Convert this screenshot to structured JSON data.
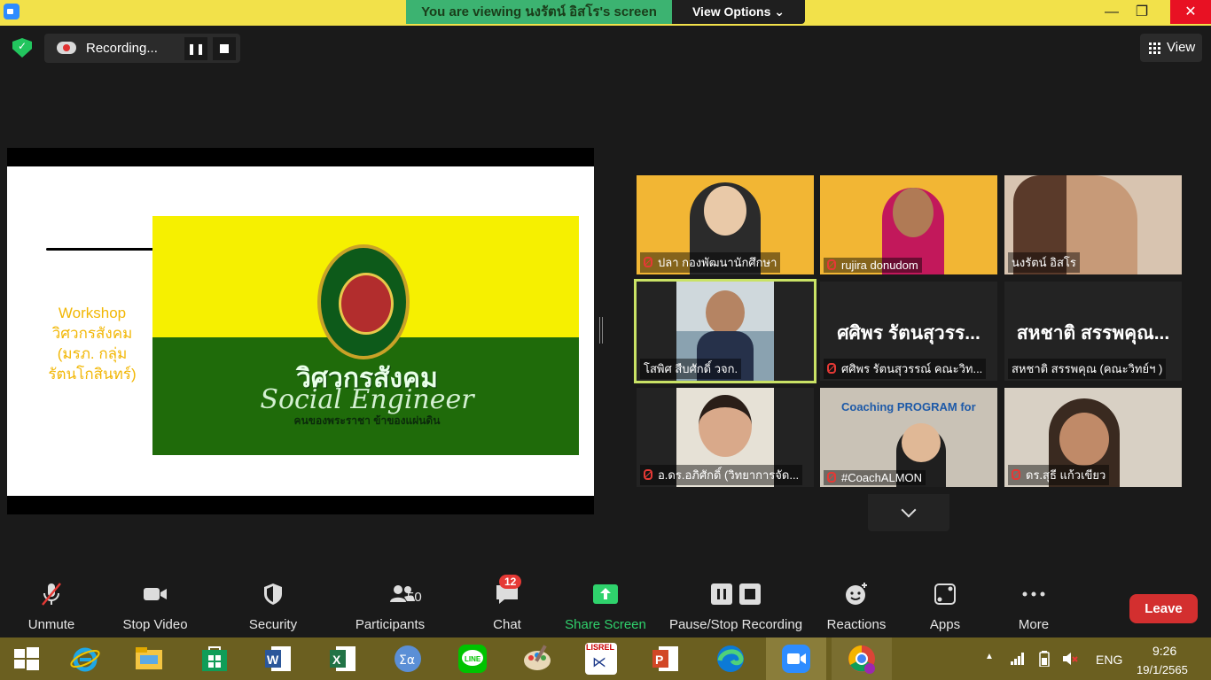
{
  "top_bar": {
    "viewing_text": "You are viewing นงรัตน์ อิสโร's screen",
    "view_options": "View Options ⌄"
  },
  "window_controls": {
    "minimize": "—",
    "restore": "❐",
    "close": "✕"
  },
  "recording": {
    "label": "Recording...",
    "pause": "❚❚"
  },
  "view_button": {
    "label": "View"
  },
  "slide": {
    "side_text_1": "Workshop",
    "side_text_2": "วิศวกรสังคม",
    "side_text_3": "(มรภ. กลุ่ม",
    "side_text_4": "รัตนโกสินทร์)",
    "banner_title": "วิศวกรสังคม",
    "banner_subtitle": "Social Engineer",
    "banner_tagline": "คนของพระราชา ข้าของแผ่นดิน"
  },
  "participants": [
    {
      "name": "ปลา กองพัฒนานักศึกษา",
      "muted": true,
      "type": "video"
    },
    {
      "name": "rujira donudom",
      "muted": true,
      "type": "video"
    },
    {
      "name": "นงรัตน์ อิสโร",
      "muted": false,
      "type": "video"
    },
    {
      "name": "โสพิศ สืบศักดิ์ วจก.",
      "muted": false,
      "type": "video",
      "active_speaker": true
    },
    {
      "name": "ศศิพร รัตนสุวรรณ์ คณะวิท...",
      "big_name": "ศศิพร รัตนสุวรร...",
      "muted": true,
      "type": "name"
    },
    {
      "name": "สหชาติ สรรพคุณ (คณะวิทย์ฯ )",
      "big_name": "สหชาติ สรรพคุณ...",
      "muted": false,
      "type": "name"
    },
    {
      "name": "อ.ดร.อภิศักดิ์ (วิทยาการจัด...",
      "muted": true,
      "type": "video"
    },
    {
      "name": "#CoachALMON",
      "muted": true,
      "type": "video",
      "overlay_text": "Coaching PROGRAM for"
    },
    {
      "name": "ดร.สุธี แก้วเขียว",
      "muted": true,
      "type": "video"
    }
  ],
  "toolbar": {
    "unmute": "Unmute",
    "stop_video": "Stop Video",
    "security": "Security",
    "participants": "Participants",
    "participants_count": "50",
    "chat": "Chat",
    "chat_badge": "12",
    "share_screen": "Share Screen",
    "pause_stop_recording": "Pause/Stop Recording",
    "reactions": "Reactions",
    "apps": "Apps",
    "more": "More",
    "leave": "Leave"
  },
  "taskbar": {
    "apps": [
      "start",
      "internet-explorer",
      "file-explorer",
      "store",
      "word",
      "excel",
      "math-input",
      "line",
      "paint",
      "lisrel",
      "powerpoint",
      "edge",
      "zoom",
      "chrome"
    ],
    "lisrel_label": "LISREL",
    "language": "ENG",
    "time": "9:26",
    "date": "19/1/2565"
  },
  "colors": {
    "top_bar": "#f2e14a",
    "viewing_banner": "#3cb371",
    "leave": "#d32f2f",
    "share_green": "#2fd26c",
    "active_speaker": "#c9e265",
    "taskbar": "#6b5f20"
  }
}
